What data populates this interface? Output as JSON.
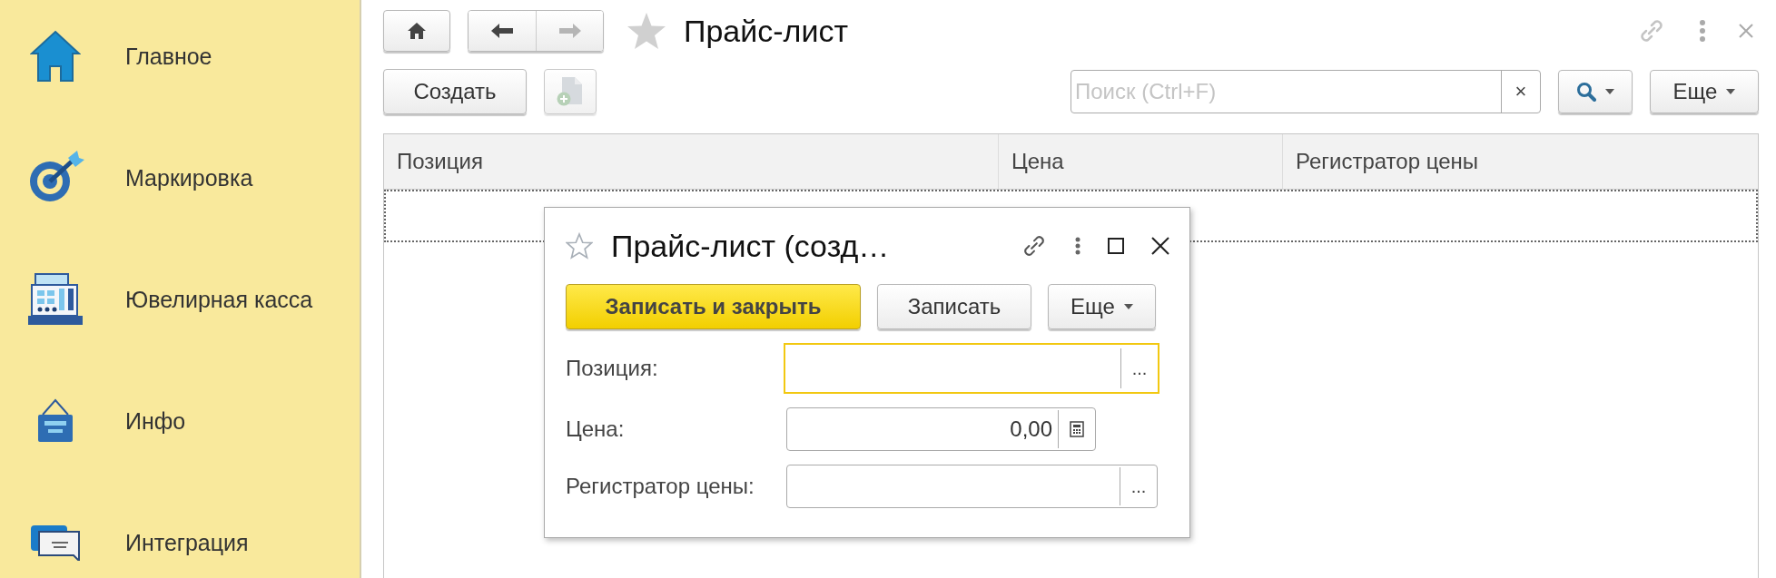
{
  "sidebar": {
    "items": [
      {
        "label": "Главное",
        "kind": "home"
      },
      {
        "label": "Маркировка",
        "kind": "target"
      },
      {
        "label": "Ювелирная касса",
        "kind": "register"
      },
      {
        "label": "Инфо",
        "kind": "sign"
      },
      {
        "label": "Интеграция",
        "kind": "chat"
      }
    ]
  },
  "nav": [
    {
      "kind": "back",
      "disabled": false
    },
    {
      "kind": "forward",
      "disabled": true
    }
  ],
  "title": "Прайс-лист",
  "toolbar": {
    "create": "Создать",
    "add_copy_disabled": true,
    "search": {
      "placeholder": "Поиск (Ctrl+F)",
      "clear": "×"
    },
    "more": "Еще"
  },
  "table": {
    "columns": [
      "Позиция",
      "Цена",
      "Регистратор цены"
    ],
    "rows": [
      {
        "selected": true
      }
    ]
  },
  "dialog": {
    "title": "Прайс-лист (созд…",
    "buttons": [
      {
        "label": "Записать и закрыть",
        "kind": "primary"
      },
      {
        "label": "Записать",
        "kind": "normal"
      },
      {
        "label": "Еще",
        "kind": "menu"
      }
    ],
    "fields": [
      {
        "label": "Позиция:",
        "kind": "choice",
        "button": "...",
        "focused": true
      },
      {
        "label": "Цена:",
        "value": "0,00",
        "kind": "calc",
        "focused": false
      },
      {
        "label": "Регистратор цены:",
        "kind": "choice",
        "button": "...",
        "focused": false
      }
    ]
  }
}
